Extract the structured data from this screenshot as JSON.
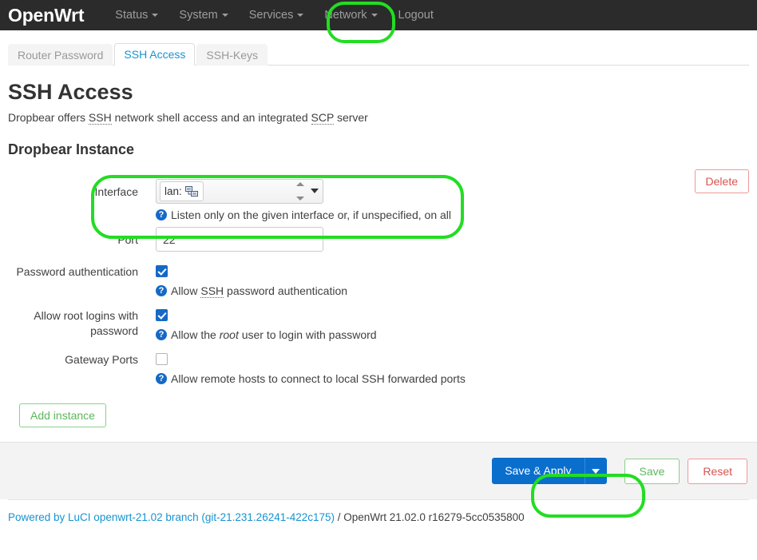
{
  "navbar": {
    "brand": "OpenWrt",
    "items": [
      {
        "label": "Status",
        "has_caret": true
      },
      {
        "label": "System",
        "has_caret": true
      },
      {
        "label": "Services",
        "has_caret": true
      },
      {
        "label": "Network",
        "has_caret": true
      },
      {
        "label": "Logout",
        "has_caret": false
      }
    ]
  },
  "tabs": [
    {
      "label": "Router Password",
      "active": false
    },
    {
      "label": "SSH Access",
      "active": true
    },
    {
      "label": "SSH-Keys",
      "active": false
    }
  ],
  "page": {
    "title": "SSH Access",
    "description_pre": "Dropbear offers ",
    "description_abbr1": "SSH",
    "description_mid": " network shell access and an integrated ",
    "description_abbr2": "SCP",
    "description_post": " server",
    "section_title": "Dropbear Instance"
  },
  "buttons": {
    "delete": "Delete",
    "add_instance": "Add instance",
    "save_apply": "Save & Apply",
    "save": "Save",
    "reset": "Reset"
  },
  "form": {
    "interface": {
      "label": "Interface",
      "value": "lan:",
      "icon": "network-ports-icon",
      "help": "Listen only on the given interface or, if unspecified, on all"
    },
    "port": {
      "label": "Port",
      "value": "22"
    },
    "password_auth": {
      "label": "Password authentication",
      "checked": true,
      "help_pre": "Allow ",
      "help_abbr": "SSH",
      "help_post": " password authentication"
    },
    "root_login": {
      "label": "Allow root logins with password",
      "checked": true,
      "help_pre": "Allow the ",
      "help_em": "root",
      "help_post": " user to login with password"
    },
    "gateway_ports": {
      "label": "Gateway Ports",
      "checked": false,
      "help": "Allow remote hosts to connect to local SSH forwarded ports"
    }
  },
  "footer": {
    "link": "Powered by LuCI openwrt-21.02 branch (git-21.231.26241-422c175)",
    "rest": " / OpenWrt 21.02.0 r16279-5cc0535800"
  },
  "colors": {
    "accent_blue": "#1793d1",
    "primary_blue": "#0a6ecd",
    "danger_red": "#d9534f",
    "success_green": "#5cb85c",
    "annotation_green": "#22dd22",
    "navbar_bg": "#2b2b2b"
  }
}
